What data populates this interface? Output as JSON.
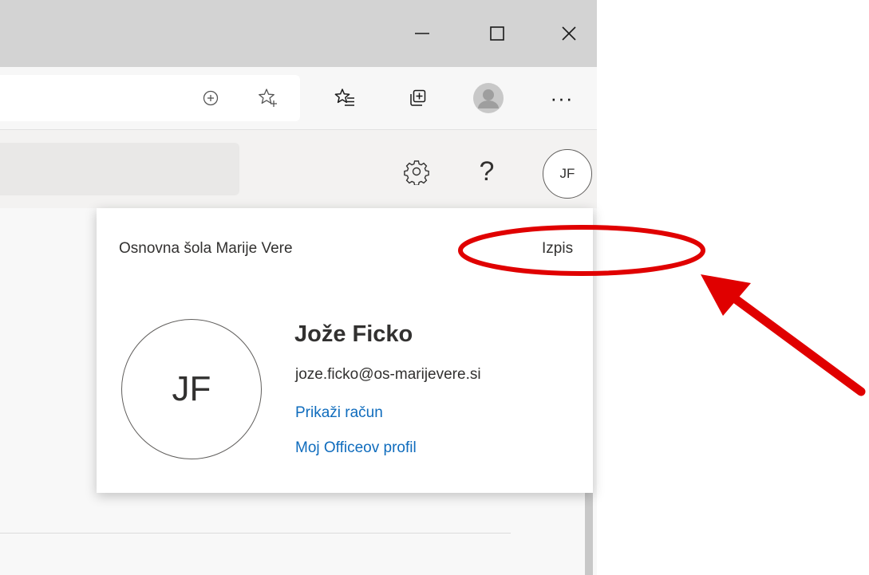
{
  "window_controls": {
    "minimize_icon": "minimize-icon",
    "maximize_icon": "maximize-icon",
    "close_icon": "close-icon"
  },
  "toolbar": {
    "icons": [
      "add-icon",
      "favorite-star-add-icon",
      "favorites-list-icon",
      "collections-icon",
      "profile-icon"
    ],
    "more_label": "···"
  },
  "office_header": {
    "settings_icon": "gear-icon",
    "help_label": "?",
    "avatar_initials": "JF"
  },
  "account_card": {
    "organization": "Osnovna šola Marije Vere",
    "signout_label": "Izpis",
    "avatar_initials": "JF",
    "user_name": "Jože Ficko",
    "user_email": "joze.ficko@os-marijevere.si",
    "view_account_label": "Prikaži račun",
    "office_profile_label": "Moj Officeov profil"
  },
  "annotation": {
    "color": "#e00000"
  },
  "colors": {
    "link": "#0f6cbd",
    "text": "#323130",
    "titlebar": "#d3d3d3"
  }
}
